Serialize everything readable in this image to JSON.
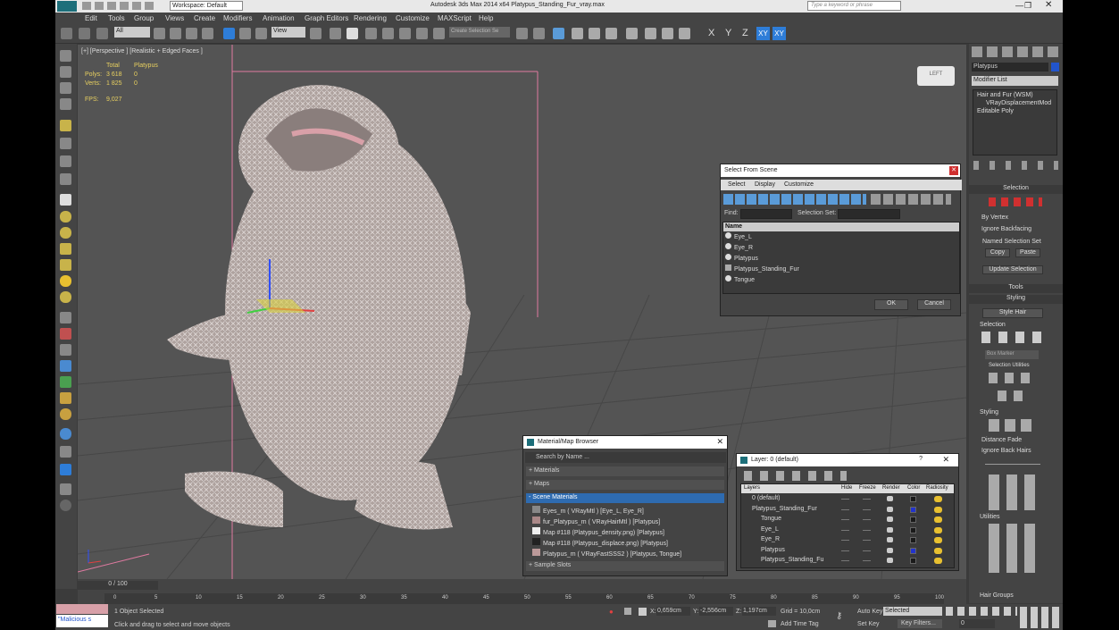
{
  "app": {
    "title": "Autodesk 3ds Max  2014 x64     Platypus_Standing_Fur_vray.max",
    "workspace": "Workspace: Default",
    "search_placeholder": "Type a keyword or phrase"
  },
  "menu": [
    "Edit",
    "Tools",
    "Group",
    "Views",
    "Create",
    "Modifiers",
    "Animation",
    "Graph Editors",
    "Rendering",
    "Customize",
    "MAXScript",
    "Help"
  ],
  "toolbar": {
    "filter": "All",
    "ref_coord": "View",
    "selection_set": "Create Selection Se",
    "axes": [
      "X",
      "Y",
      "Z",
      "XY",
      "XY"
    ]
  },
  "viewport": {
    "label": "[+] [Perspective ] [Realistic + Edged Faces ]",
    "stats_headers": [
      "Total",
      "Platypus"
    ],
    "stats": [
      {
        "label": "Polys:",
        "total": "3 618",
        "sel": "0"
      },
      {
        "label": "Verts:",
        "total": "1 825",
        "sel": "0"
      }
    ],
    "fps_label": "FPS:",
    "fps": "9,027",
    "cube_label": "LEFT"
  },
  "select_dialog": {
    "title": "Select From Scene",
    "menus": [
      "Select",
      "Display",
      "Customize"
    ],
    "find_label": "Find:",
    "set_label": "Selection Set:",
    "col_header": "Name",
    "items": [
      "Eye_L",
      "Eye_R",
      "Platypus",
      "Platypus_Standing_Fur",
      "Tongue"
    ],
    "ok": "OK",
    "cancel": "Cancel"
  },
  "material_browser": {
    "title": "Material/Map Browser",
    "search_placeholder": "Search by Name ...",
    "groups": [
      "+ Materials",
      "+ Maps",
      "- Scene Materials"
    ],
    "items": [
      "Eyes_m  ( VRayMtl ) [Eye_L, Eye_R]",
      "fur_Platypus_m  ( VRayHairMtl ) [Platypus]",
      "Map #118 (Platypus_density.png) [Platypus]",
      "Map #118 (Platypus_displace.png) [Platypus]",
      "Platypus_m  ( VRayFastSSS2 ) [Platypus, Tongue]"
    ],
    "footer": "+ Sample Slots"
  },
  "layer_dialog": {
    "title": "Layer: 0 (default)",
    "help": "?",
    "columns": [
      "Layers",
      "Hide",
      "Freeze",
      "Render",
      "Color",
      "Radiosity"
    ],
    "rows": [
      {
        "name": "0 (default)",
        "color": "#1a1a1a"
      },
      {
        "name": "Platypus_Standing_Fur",
        "color": "#2233cc"
      },
      {
        "name": "Tongue",
        "color": "#1a1a1a"
      },
      {
        "name": "Eye_L",
        "color": "#1a1a1a"
      },
      {
        "name": "Eye_R",
        "color": "#1a1a1a"
      },
      {
        "name": "Platypus",
        "color": "#2233cc"
      },
      {
        "name": "Platypus_Standing_Fu",
        "color": "#1a1a1a"
      }
    ]
  },
  "command_panel": {
    "object_name": "Platypus",
    "modifier_list": "Modifier List",
    "stack": [
      "Hair and Fur (WSM)",
      "VRayDisplacementMod",
      "Editable Poly"
    ],
    "selection_title": "Selection",
    "by_vertex": "By Vertex",
    "ignore_backfacing": "Ignore Backfacing",
    "named_sel": "Named Selection Set",
    "copy": "Copy",
    "paste": "Paste",
    "update_sel": "Update Selection",
    "tools": "Tools",
    "styling": "Styling",
    "style_hair": "Style Hair",
    "sel2": "Selection",
    "box_marker": "Box Marker",
    "sel_util": "Selection Utilities",
    "styling2": "Styling",
    "distance_fade": "Distance Fade",
    "ignore_back_hairs": "Ignore Back Hairs",
    "utilities": "Utilities",
    "hair_groups": "Hair Groups"
  },
  "timeline": {
    "frame": "0 / 100",
    "ticks": [
      "0",
      "5",
      "10",
      "15",
      "20",
      "25",
      "30",
      "35",
      "40",
      "45",
      "50",
      "55",
      "60",
      "65",
      "70",
      "75",
      "80",
      "85",
      "90",
      "95",
      "100"
    ]
  },
  "status": {
    "script": "\"Malicious s",
    "selected": "1 Object Selected",
    "hint": "Click and drag to select and move objects",
    "x_label": "X:",
    "x": "0,659cm",
    "y_label": "Y:",
    "y": "-2,556cm",
    "z_label": "Z:",
    "z": "1,197cm",
    "grid": "Grid = 10,0cm",
    "add_time_tag": "Add Time Tag",
    "auto_key": "Auto Key",
    "auto_key_value": "Selected",
    "set_key": "Set Key",
    "key_filters": "Key Filters...",
    "frame_value": "0"
  }
}
